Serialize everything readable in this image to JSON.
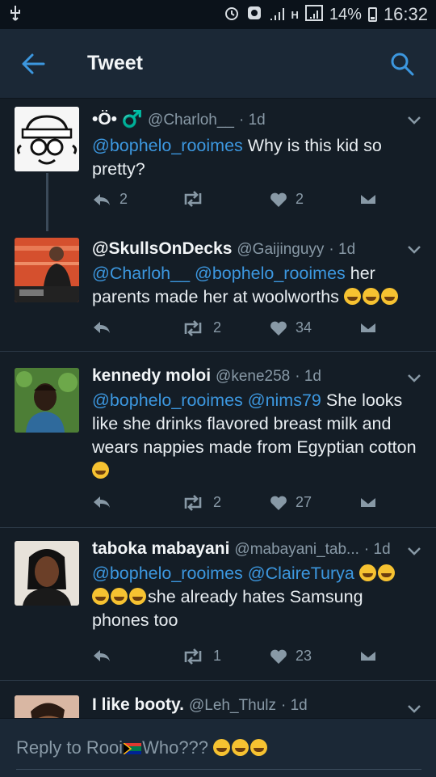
{
  "status": {
    "battery": "14%",
    "time": "16:32",
    "network": "H"
  },
  "appbar": {
    "title": "Tweet"
  },
  "tweets": [
    {
      "name": "•Ö• ♂️",
      "handle": "@Charloh__",
      "time": "· 1d",
      "body_mentions": "@bophelo_rooimes",
      "body_text": " Why is this kid so pretty?",
      "replies": "2",
      "retweets": "",
      "likes": "2"
    },
    {
      "name": "@SkullsOnDecks",
      "handle": "@Gaijinguyy",
      "time": "· 1d",
      "body_mentions": "@Charloh__ @bophelo_rooimes",
      "body_text": " her parents made her at woolworths ",
      "emoji_count": 3,
      "replies": "",
      "retweets": "2",
      "likes": "34"
    },
    {
      "name": "kennedy moloi",
      "handle": "@kene258",
      "time": "· 1d",
      "body_mentions": "@bophelo_rooimes @nims79",
      "body_text": " She looks like she drinks flavored breast milk and wears nappies made from Egyptian cotton ",
      "emoji_count": 1,
      "replies": "",
      "retweets": "2",
      "likes": "27"
    },
    {
      "name": "taboka mabayani",
      "handle": "@mabayani_tab...",
      "time": "· 1d",
      "body_mentions": "@bophelo_rooimes @ClaireTurya",
      "body_text": "she already hates Samsung phones too",
      "replies": "",
      "retweets": "1",
      "likes": "23"
    },
    {
      "name": "I like booty.",
      "handle": "@Leh_Thulz",
      "time": "· 1d"
    }
  ],
  "reply": {
    "prefix": "Reply to Rooi",
    "suffix": "Who???"
  },
  "colors": {
    "background": "#141d26",
    "bar": "#1b2836",
    "accent": "#3c97df",
    "muted": "#8899a6"
  },
  "icons": [
    "back-arrow-icon",
    "search-icon",
    "chevron-down-icon",
    "reply-icon",
    "retweet-icon",
    "like-icon",
    "share-icon"
  ]
}
